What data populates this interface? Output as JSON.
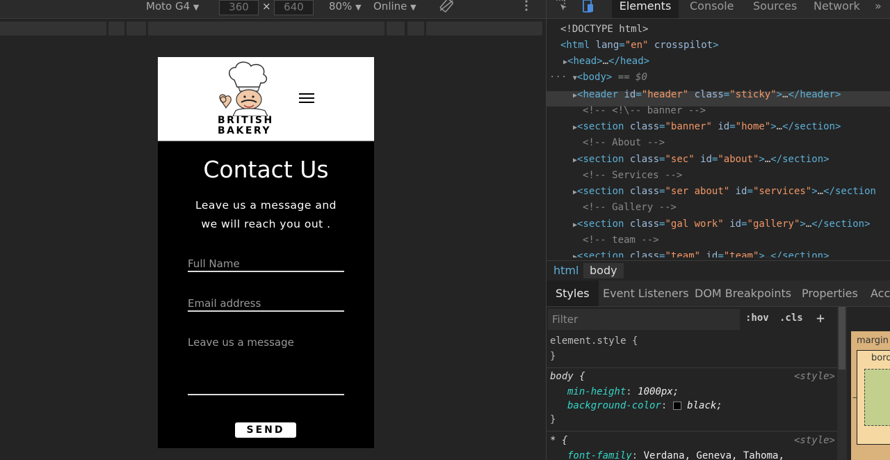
{
  "device_toolbar": {
    "device": "Moto G4",
    "width": "360",
    "times": "×",
    "height": "640",
    "zoom": "80%",
    "throttle": "Online",
    "caret": "▼",
    "rotate_icon": "rotate-icon",
    "more_icon": "more-vert-icon"
  },
  "site": {
    "brand_line1": "BRITISH",
    "brand_line2": "BAKERY",
    "title": "Contact Us",
    "subtitle": "Leave us a message and we will reach you out .",
    "name_placeholder": "Full Name",
    "email_placeholder": "Email address",
    "message_placeholder": "Leave us a message",
    "send_label": "SEND"
  },
  "devtools": {
    "tabs": [
      "Elements",
      "Console",
      "Sources",
      "Network",
      "»"
    ],
    "dom": {
      "doctype": "<!DOCTYPE html>",
      "html_open": "<html lang=\"en\" crosspilot>",
      "head": "<head>…</head>",
      "body_sel": "== $0",
      "comment_banner": "<!-- <!\\-- banner -->",
      "comment_about": "<!-- About  -->",
      "comment_services": "<!-- Services  -->",
      "comment_gallery": "<!-- Gallery -->",
      "comment_team": "<!-- team  -->"
    },
    "breadcrumbs": [
      "html",
      "body"
    ],
    "styles_tabs": [
      "Styles",
      "Event Listeners",
      "DOM Breakpoints",
      "Properties",
      "Acc"
    ],
    "filter_placeholder": "Filter",
    "hov": ":hov",
    "cls": ".cls",
    "plus": "+",
    "rules": {
      "element_style": "element.style {",
      "close": "}",
      "body_selector": "body {",
      "body_source": "<style>",
      "min_height_prop": "min-height",
      "min_height_val": "1000px;",
      "bg_prop": "background-color",
      "bg_val": "black;",
      "star_selector": "* {",
      "star_source": "<style>",
      "font_prop": "font-family",
      "font_val": "Verdana, Geneva, Tahoma,"
    },
    "box_model": {
      "margin": "margin",
      "border": "bord",
      "dash": "–"
    }
  },
  "colors": {
    "tag": "#5db0d7",
    "attr_value": "#f29766",
    "prop": "#35d4c7",
    "box_margin": "#d9b27c"
  }
}
